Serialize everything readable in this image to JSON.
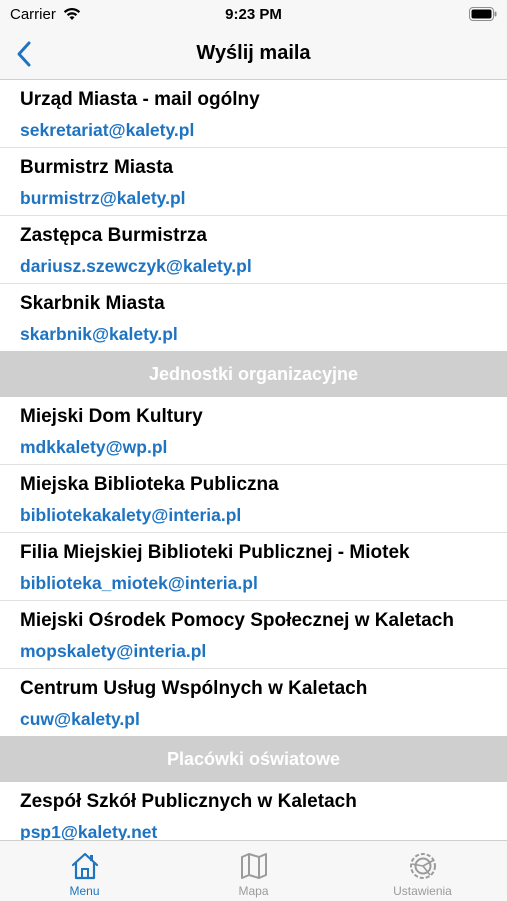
{
  "status_bar": {
    "carrier": "Carrier",
    "time": "9:23 PM"
  },
  "nav": {
    "title": "Wyślij maila",
    "back_icon": "chevron-left-icon"
  },
  "sections": [
    {
      "header": "",
      "items": [
        {
          "name": "Urząd Miasta - mail ogólny",
          "email": "sekretariat@kalety.pl"
        },
        {
          "name": "Burmistrz Miasta",
          "email": "burmistrz@kalety.pl"
        },
        {
          "name": "Zastępca Burmistrza",
          "email": "dariusz.szewczyk@kalety.pl"
        },
        {
          "name": "Skarbnik Miasta",
          "email": "skarbnik@kalety.pl"
        }
      ]
    },
    {
      "header": "Jednostki organizacyjne",
      "items": [
        {
          "name": "Miejski Dom Kultury",
          "email": "mdkkalety@wp.pl"
        },
        {
          "name": "Miejska Biblioteka Publiczna",
          "email": "bibliotekakalety@interia.pl"
        },
        {
          "name": "Filia Miejskiej Biblioteki Publicznej - Miotek",
          "email": "biblioteka_miotek@interia.pl"
        },
        {
          "name": "Miejski Ośrodek Pomocy Społecznej w Kaletach",
          "email": "mopskalety@interia.pl"
        },
        {
          "name": "Centrum Usług Wspólnych w Kaletach",
          "email": "cuw@kalety.pl"
        }
      ]
    },
    {
      "header": "Placówki oświatowe",
      "items": [
        {
          "name": "Zespół Szkół Publicznych w Kaletach",
          "email": "psp1@kalety.net"
        }
      ]
    }
  ],
  "tabs": [
    {
      "label": "Menu",
      "icon": "home-icon",
      "active": true
    },
    {
      "label": "Mapa",
      "icon": "map-icon",
      "active": false
    },
    {
      "label": "Ustawienia",
      "icon": "settings-icon",
      "active": false
    }
  ],
  "colors": {
    "accent": "#1f74c2",
    "section_bg": "#cfcfcf",
    "bar_bg": "#f7f7f7"
  }
}
